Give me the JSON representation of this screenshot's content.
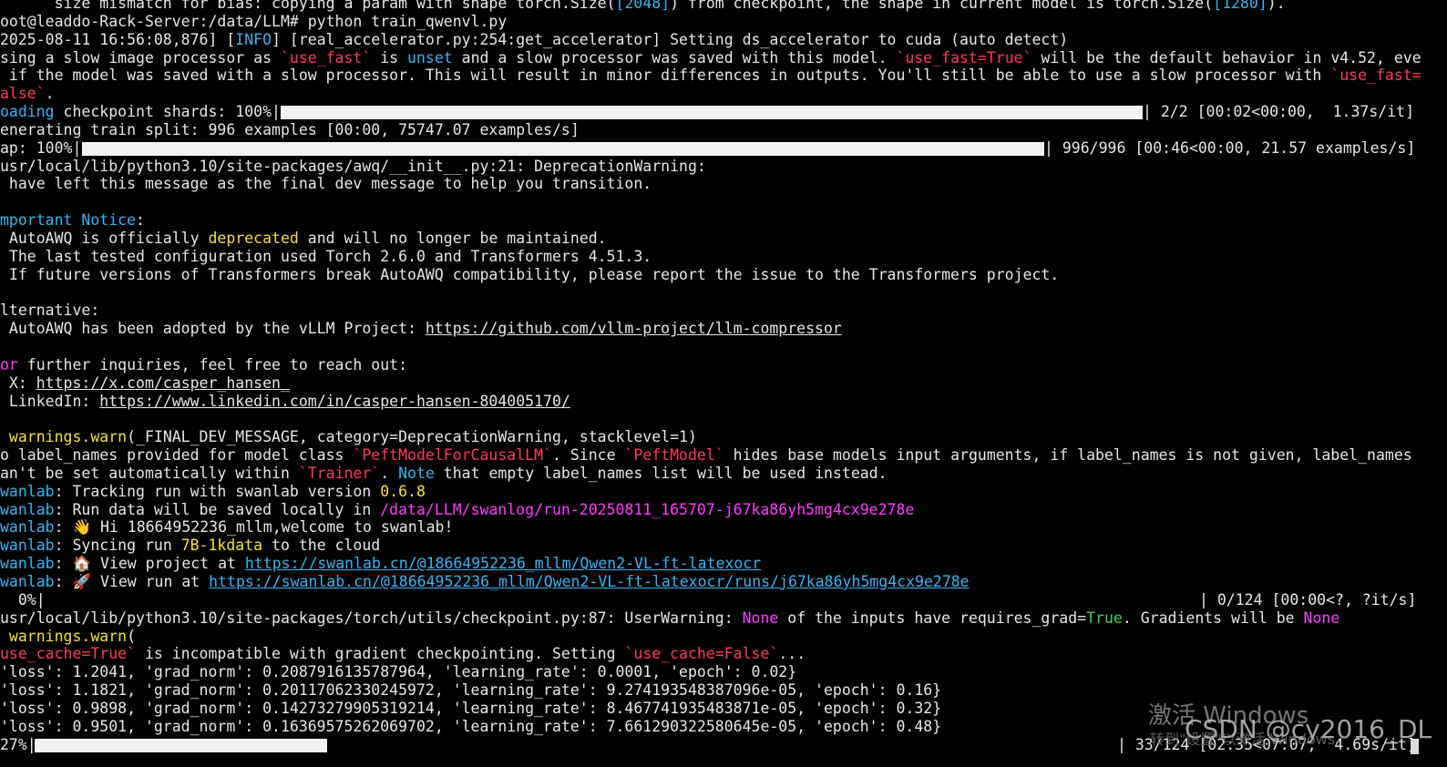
{
  "terminal": {
    "lines": [
      {
        "segs": [
          {
            "t": "      size mismatch for bias: copying a param with shape torch.Size("
          },
          {
            "t": "[2048]",
            "c": "kw"
          },
          {
            "t": ") from checkpoint, the shape in current model is torch.Size("
          },
          {
            "t": "[1280]",
            "c": "kw"
          },
          {
            "t": ")."
          }
        ]
      },
      {
        "segs": [
          {
            "t": "oot@leaddo-Rack-Server:/data/LLM# python train_qwenvl.py"
          }
        ]
      },
      {
        "segs": [
          {
            "t": "2025-08-11 16:56:08,876] ["
          },
          {
            "t": "INFO",
            "c": "kw"
          },
          {
            "t": "] [real_accelerator.py:254:get_accelerator] Setting ds_accelerator to cuda (auto detect)"
          }
        ]
      },
      {
        "segs": [
          {
            "t": "sing a slow image processor as "
          },
          {
            "t": "`use_fast`",
            "c": "code"
          },
          {
            "t": " is "
          },
          {
            "t": "unset",
            "c": "kw"
          },
          {
            "t": " and a slow processor was saved with this model. "
          },
          {
            "t": "`use_fast=True`",
            "c": "code"
          },
          {
            "t": " will be the default behavior in v4.52, eve"
          }
        ]
      },
      {
        "segs": [
          {
            "t": " if the model was saved with a slow processor. This will result in minor differences in outputs. You'll still be able to use a slow processor with "
          },
          {
            "t": "`use_fast=",
            "c": "code"
          }
        ]
      },
      {
        "segs": [
          {
            "t": "alse`",
            "c": "code"
          },
          {
            "t": "."
          }
        ]
      },
      {
        "progress": true,
        "segs": [
          {
            "t": "oading",
            "c": "kw"
          },
          {
            "t": " checkpoint shards: 100%|"
          }
        ],
        "fill": 1.0,
        "tail": "| 2/2 [00:02<00:00,  1.37s/it]"
      },
      {
        "segs": [
          {
            "t": "enerating train split: 996 examples [00:00, 75747.07 examples/s]"
          }
        ]
      },
      {
        "progress": true,
        "segs": [
          {
            "t": "ap: 100%|"
          }
        ],
        "fill": 1.0,
        "tail": "| 996/996 [00:46<00:00, 21.57 examples/s]"
      },
      {
        "segs": [
          {
            "t": "usr/local/lib/python3.10/site-packages/awq/__init__.py:21: DeprecationWarning:"
          }
        ]
      },
      {
        "segs": [
          {
            "t": " have left this message as the final dev message to help you transition."
          }
        ]
      },
      {
        "segs": [
          {
            "t": ""
          }
        ]
      },
      {
        "segs": [
          {
            "t": "mportant ",
            "c": "kw"
          },
          {
            "t": "Notice",
            "c": "kw"
          },
          {
            "t": ":"
          }
        ]
      },
      {
        "segs": [
          {
            "t": " AutoAWQ is officially "
          },
          {
            "t": "deprecated",
            "c": "yel"
          },
          {
            "t": " and will no longer be maintained."
          }
        ]
      },
      {
        "segs": [
          {
            "t": " The last tested configuration used Torch 2.6.0 and Transformers 4.51.3."
          }
        ]
      },
      {
        "segs": [
          {
            "t": " If future versions of Transformers break AutoAWQ compatibility, please report the issue to the Transformers project."
          }
        ]
      },
      {
        "segs": [
          {
            "t": ""
          }
        ]
      },
      {
        "segs": [
          {
            "t": "lternative:"
          }
        ]
      },
      {
        "segs": [
          {
            "t": " AutoAWQ has been adopted by the vLLM Project: "
          },
          {
            "t": "https://github.com/vllm-project/llm-compressor",
            "c": "url"
          }
        ]
      },
      {
        "segs": [
          {
            "t": ""
          }
        ]
      },
      {
        "segs": [
          {
            "t": "or",
            "c": "mag"
          },
          {
            "t": " further inquiries, feel free to reach out:"
          }
        ]
      },
      {
        "segs": [
          {
            "t": " X: "
          },
          {
            "t": "https://x.com/casper_hansen_",
            "c": "url"
          }
        ]
      },
      {
        "segs": [
          {
            "t": " LinkedIn: "
          },
          {
            "t": "https://www.linkedin.com/in/casper-hansen-804005170/",
            "c": "url"
          }
        ]
      },
      {
        "segs": [
          {
            "t": ""
          }
        ]
      },
      {
        "segs": [
          {
            "t": " warnings.warn",
            "c": "yel"
          },
          {
            "t": "(_FINAL_DEV_MESSAGE, category=DeprecationWarning, stacklevel=1)"
          }
        ]
      },
      {
        "segs": [
          {
            "t": "o label_names provided for model class "
          },
          {
            "t": "`PeftModelForCausalLM`",
            "c": "code"
          },
          {
            "t": ". Since "
          },
          {
            "t": "`PeftModel`",
            "c": "code"
          },
          {
            "t": " hides base models input arguments, if label_names is not given, label_names"
          }
        ]
      },
      {
        "segs": [
          {
            "t": "an't be set automatically within "
          },
          {
            "t": "`Trainer`",
            "c": "code"
          },
          {
            "t": ". "
          },
          {
            "t": "Note",
            "c": "kw"
          },
          {
            "t": " that empty label_names list will be used instead."
          }
        ]
      },
      {
        "segs": [
          {
            "t": "wanlab",
            "c": "kw"
          },
          {
            "t": ": Tracking run with swanlab version "
          },
          {
            "t": "0.6.8",
            "c": "yel"
          }
        ]
      },
      {
        "segs": [
          {
            "t": "wanlab",
            "c": "kw"
          },
          {
            "t": ": Run data will be saved locally in "
          },
          {
            "t": "/data/LLM/swanlog/run-20250811_165707-j67ka86yh5mg4cx9e278e",
            "c": "mag"
          }
        ]
      },
      {
        "segs": [
          {
            "t": "wanlab",
            "c": "kw"
          },
          {
            "t": ": 👋 Hi 18664952236_mllm,welcome to swanlab!"
          }
        ]
      },
      {
        "segs": [
          {
            "t": "wanlab",
            "c": "kw"
          },
          {
            "t": ": Syncing run "
          },
          {
            "t": "7B-1kdata",
            "c": "yel"
          },
          {
            "t": " to the cloud"
          }
        ]
      },
      {
        "segs": [
          {
            "t": "wanlab",
            "c": "kw"
          },
          {
            "t": ": 🏠 View project at "
          },
          {
            "t": "https://swanlab.cn/@18664952236_mllm/Qwen2-VL-ft-latexocr",
            "c": "link"
          }
        ]
      },
      {
        "segs": [
          {
            "t": "wanlab",
            "c": "kw"
          },
          {
            "t": ": 🚀 View run at "
          },
          {
            "t": "https://swanlab.cn/@18664952236_mllm/Qwen2-VL-ft-latexocr/runs/j67ka86yh5mg4cx9e278e",
            "c": "link"
          }
        ]
      },
      {
        "progress": true,
        "segs": [
          {
            "t": "  0%|"
          }
        ],
        "fill": 0.0,
        "tail": "| 0/124 [00:00<?, ?it/s]"
      },
      {
        "segs": [
          {
            "t": "usr/local/lib/python3.10/site-packages/torch/utils/checkpoint.py:87: UserWarning: "
          },
          {
            "t": "None",
            "c": "mag"
          },
          {
            "t": " of the inputs have requires_grad="
          },
          {
            "t": "True",
            "c": "grn"
          },
          {
            "t": ". Gradients will be "
          },
          {
            "t": "None",
            "c": "mag"
          }
        ]
      },
      {
        "segs": [
          {
            "t": " warnings.warn",
            "c": "yel"
          },
          {
            "t": "("
          }
        ]
      },
      {
        "segs": [
          {
            "t": "use_cache=True`",
            "c": "code"
          },
          {
            "t": " is incompatible with gradient checkpointing. Setting "
          },
          {
            "t": "`use_cache=False`",
            "c": "code"
          },
          {
            "t": "..."
          }
        ]
      },
      {
        "segs": [
          {
            "t": "'loss': 1.2041, 'grad_norm': 0.2087916135787964, 'learning_rate': 0.0001, 'epoch': 0.02}"
          }
        ]
      },
      {
        "segs": [
          {
            "t": "'loss': 1.1821, 'grad_norm': 0.20117062330245972, 'learning_rate': 9.274193548387096e-05, 'epoch': 0.16}"
          }
        ]
      },
      {
        "segs": [
          {
            "t": "'loss': 0.9898, 'grad_norm': 0.14273279905319214, 'learning_rate': 8.467741935483871e-05, 'epoch': 0.32}"
          }
        ]
      },
      {
        "segs": [
          {
            "t": "'loss': 0.9501, 'grad_norm': 0.16369575262069702, 'learning_rate': 7.661290322580645e-05, 'epoch': 0.48}"
          }
        ]
      },
      {
        "progress": true,
        "segs": [
          {
            "t": "27%|"
          }
        ],
        "fill": 0.27,
        "tail": "| 33/124 [02:35<07:07,  4.69s/it]"
      }
    ]
  },
  "watermark": {
    "activate": "激活 Windows",
    "goto": "转到\"设置\"以激活 Windows。",
    "csdn": "CSDN @cy2016_DL"
  },
  "colors": {
    "code": "#ff3b57",
    "kw": "#35b6f0",
    "yel": "#f2e034",
    "mag": "#ff3cff",
    "grn": "#3ad34a"
  }
}
